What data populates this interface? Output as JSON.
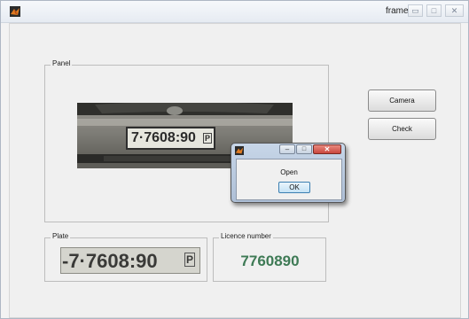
{
  "window": {
    "title": "frame",
    "controls": {
      "minimize": "▭",
      "maximize": "□",
      "close": "✕"
    }
  },
  "panel": {
    "legend": "Panel",
    "photo_plate_text": "7·7608:90",
    "photo_plate_side": "P"
  },
  "buttons": {
    "camera": "Camera",
    "check": "Check"
  },
  "plate_box": {
    "legend": "Plate",
    "plate_text": "-7·7608:90",
    "plate_side": "P"
  },
  "licence_box": {
    "legend": "Licence number",
    "value": "7760890"
  },
  "dialog": {
    "message": "Open",
    "ok_label": "OK",
    "controls": {
      "minimize": "–",
      "maximize": "□",
      "close": "✕"
    }
  },
  "colors": {
    "licence_text": "#3e7a55",
    "dialog_close": "#c9463d"
  }
}
